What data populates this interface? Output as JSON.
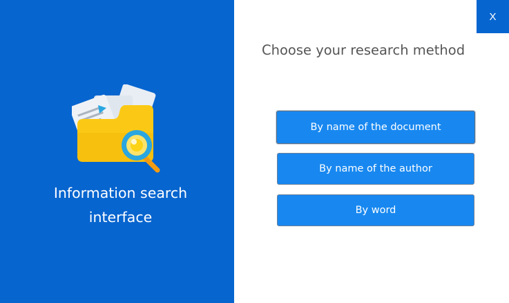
{
  "window": {
    "close_label": "X"
  },
  "sidebar": {
    "title_line1": "Information search",
    "title_line2": "interface",
    "icon": "folder-search-icon"
  },
  "main": {
    "heading": "Choose your research method",
    "buttons": [
      {
        "label": "By name of the document",
        "active": true
      },
      {
        "label": "By name of the author",
        "active": false
      },
      {
        "label": "By word",
        "active": false
      }
    ]
  },
  "colors": {
    "sidebar_blue": "#0765cf",
    "button_blue": "#1888f0",
    "heading_gray": "#555555",
    "folder_yellow": "#f9c80e",
    "magnifier_orange": "#f39c12",
    "magnifier_blue": "#2aa6e0"
  }
}
